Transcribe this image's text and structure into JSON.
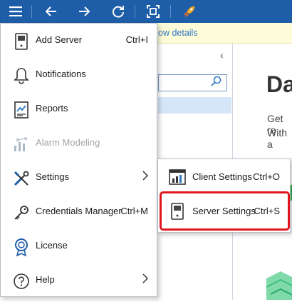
{
  "background": {
    "info_link": "ow details",
    "title_fragment": "Da",
    "subtitle_line1": "Get re",
    "subtitle_line2": "With a"
  },
  "menu": {
    "items": [
      {
        "label": "Add Server",
        "shortcut": "Ctrl+I",
        "icon": "server-icon"
      },
      {
        "label": "Notifications",
        "shortcut": "",
        "icon": "bell-icon"
      },
      {
        "label": "Reports",
        "shortcut": "",
        "icon": "report-icon"
      },
      {
        "label": "Alarm Modeling",
        "shortcut": "",
        "icon": "alarm-modeling-icon",
        "disabled": true
      },
      {
        "label": "Settings",
        "shortcut": "",
        "icon": "wrench-screwdriver-icon",
        "has_submenu": true
      },
      {
        "label": "Credentials Manager",
        "shortcut": "Ctrl+M",
        "icon": "key-icon"
      },
      {
        "label": "License",
        "shortcut": "",
        "icon": "license-badge-icon"
      },
      {
        "label": "Help",
        "shortcut": "",
        "icon": "help-icon",
        "has_submenu": true
      }
    ]
  },
  "submenu": {
    "items": [
      {
        "label": "Client Settings",
        "shortcut": "Ctrl+O",
        "icon": "client-settings-icon"
      },
      {
        "label": "Server Settings",
        "shortcut": "Ctrl+S",
        "icon": "server-icon",
        "highlighted": true
      }
    ]
  },
  "colors": {
    "toolbar": "#1e5ea8",
    "highlight": "#e0151e",
    "disabled_text": "#a4a4a4"
  }
}
